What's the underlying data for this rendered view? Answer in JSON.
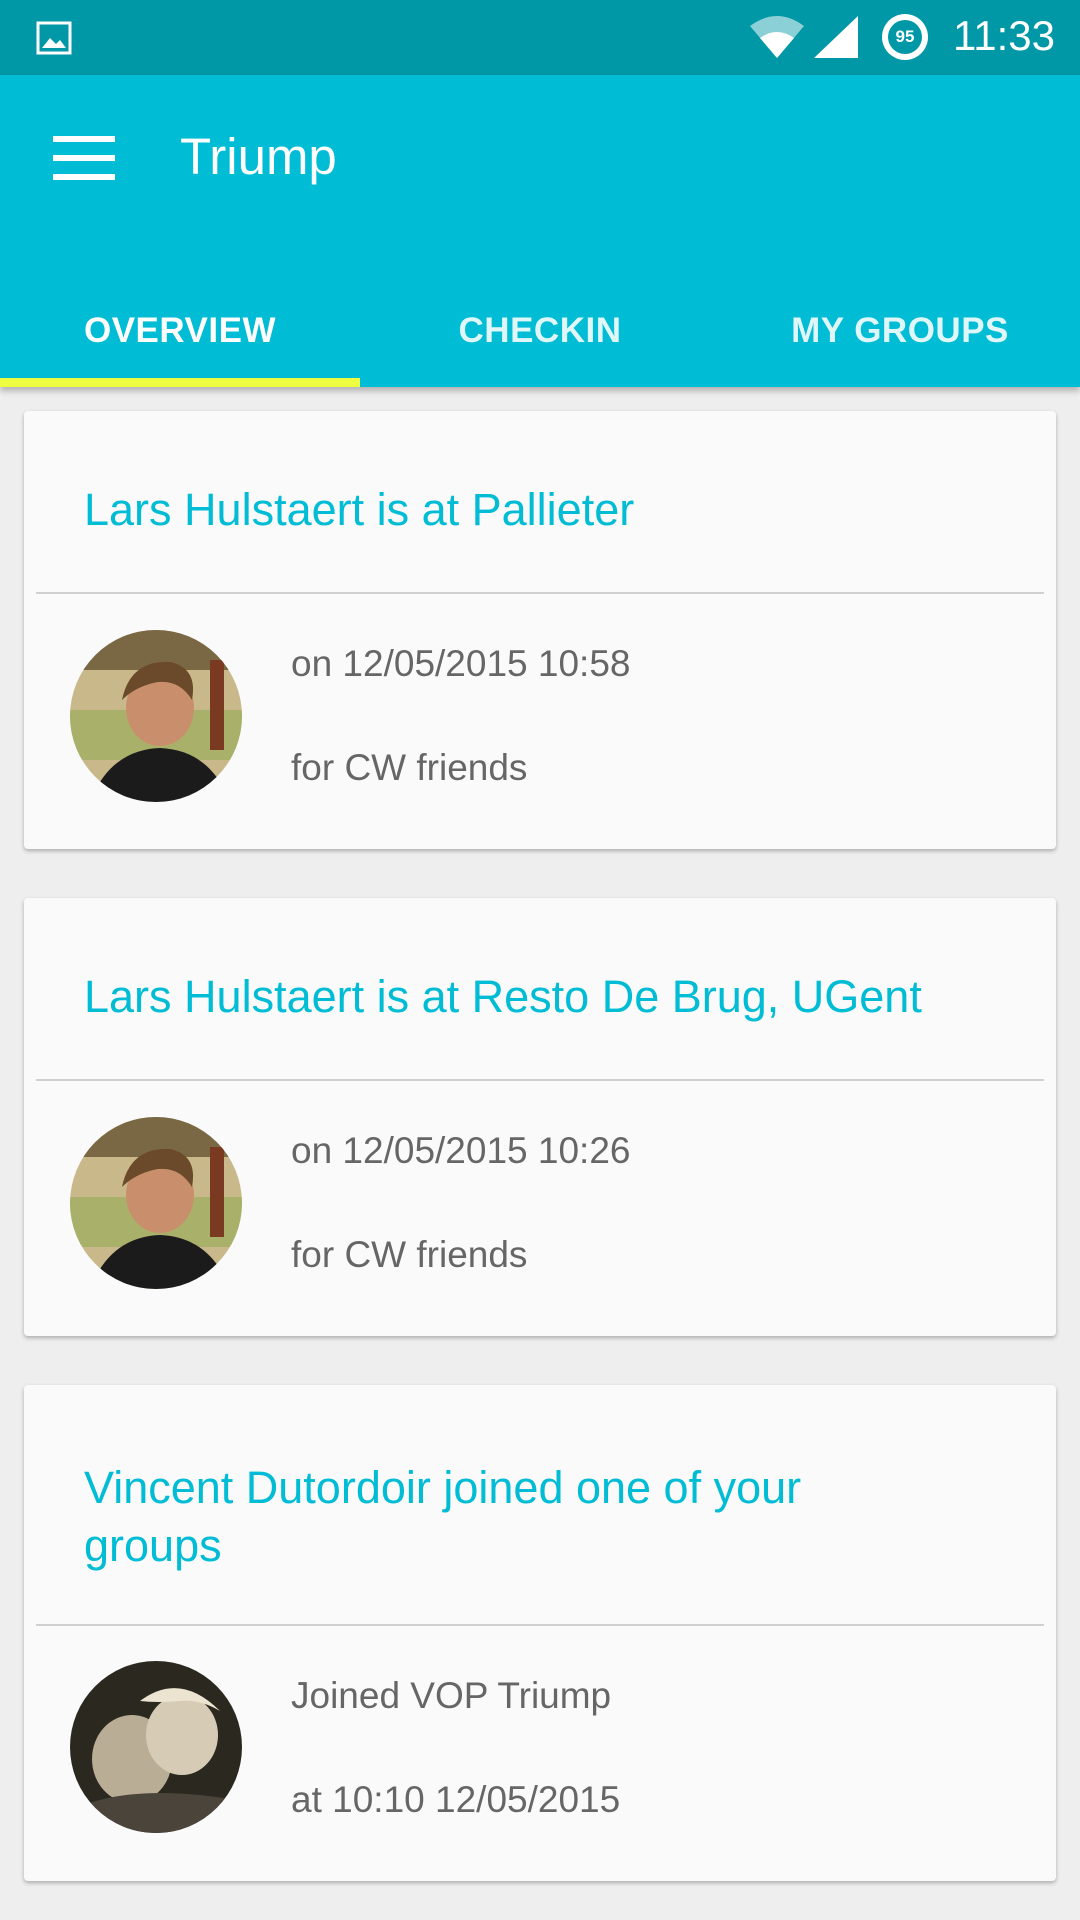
{
  "status_bar": {
    "time": "11:33",
    "battery_level": "95",
    "icons": [
      "gallery-icon",
      "wifi-icon",
      "cell-signal-icon",
      "battery-icon"
    ]
  },
  "app_bar": {
    "title": "Triump",
    "menu_icon": "menu-icon"
  },
  "tabs": [
    {
      "label": "OVERVIEW",
      "active": true
    },
    {
      "label": "CHECKIN",
      "active": false
    },
    {
      "label": "MY GROUPS",
      "active": false
    }
  ],
  "colors": {
    "primary": "#00bcd4",
    "primary_dark": "#0097a7",
    "tab_indicator": "#eeff41",
    "card_title": "#00bcd4",
    "secondary_text": "#666666",
    "background": "#eeeeee"
  },
  "feed": [
    {
      "title": "Lars Hulstaert is at Pallieter",
      "line1": "on 12/05/2015 10:58",
      "line2": "for CW friends",
      "avatar": "avatar-lars"
    },
    {
      "title": "Lars Hulstaert is at Resto De Brug, UGent",
      "line1": "on 12/05/2015 10:26",
      "line2": "for CW friends",
      "avatar": "avatar-lars"
    },
    {
      "title": "Vincent Dutordoir joined one of your groups",
      "line1": "Joined VOP Triump",
      "line2": "at 10:10 12/05/2015",
      "avatar": "avatar-vincent"
    }
  ]
}
